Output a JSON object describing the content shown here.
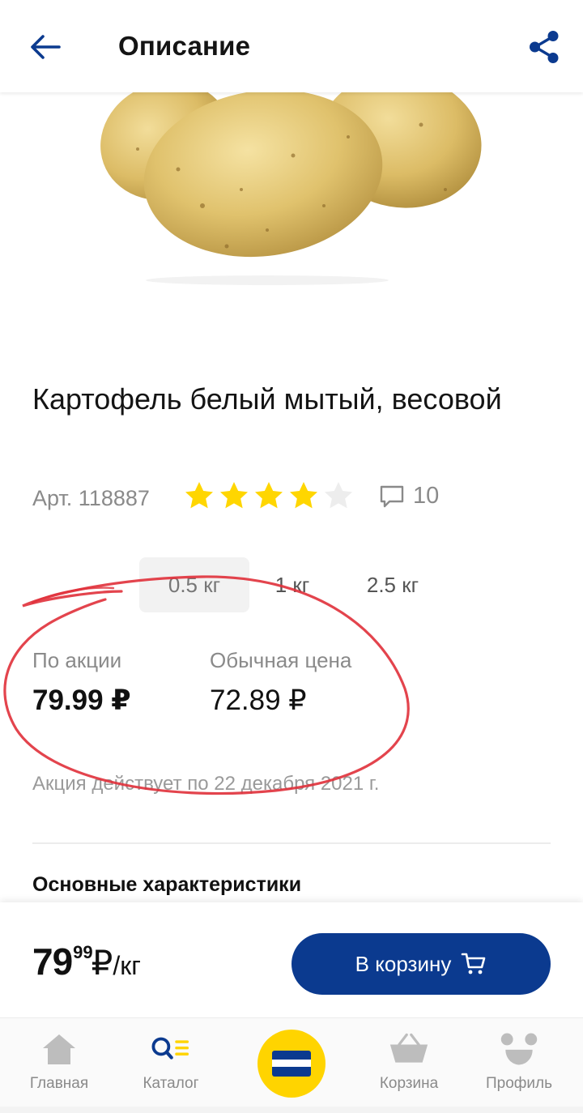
{
  "header": {
    "title": "Описание",
    "back_icon": "arrow-left-icon",
    "share_icon": "share-icon",
    "accent_color": "#0b3a8f"
  },
  "product": {
    "image": "potatoes-photo",
    "name": "Картофель белый мытый, весовой",
    "article": "Арт. 118887",
    "rating": 4,
    "rating_max": 5,
    "reviews_count": "10",
    "weights": [
      "0.5 кг",
      "1 кг",
      "2.5 кг"
    ],
    "selected_weight": "0.5 кг"
  },
  "prices": {
    "promo_label": "По акции",
    "promo_value": "79.99 ₽",
    "regular_label": "Обычная цена",
    "regular_value": "72.89 ₽",
    "promo_until": "Акция действует по 22 декабря 2021 г."
  },
  "section": {
    "title": "Основные характеристики"
  },
  "buybar": {
    "price_rub": "79",
    "price_kop": "99",
    "currency": "₽",
    "unit": "/кг",
    "cart_button_label": "В корзину",
    "button_color": "#0b3a8f"
  },
  "nav": {
    "home": "Главная",
    "catalog": "Каталог",
    "cart": "Корзина",
    "profile": "Профиль",
    "card_color": "#ffd400"
  },
  "annotation": {
    "color": "#e0303a"
  }
}
